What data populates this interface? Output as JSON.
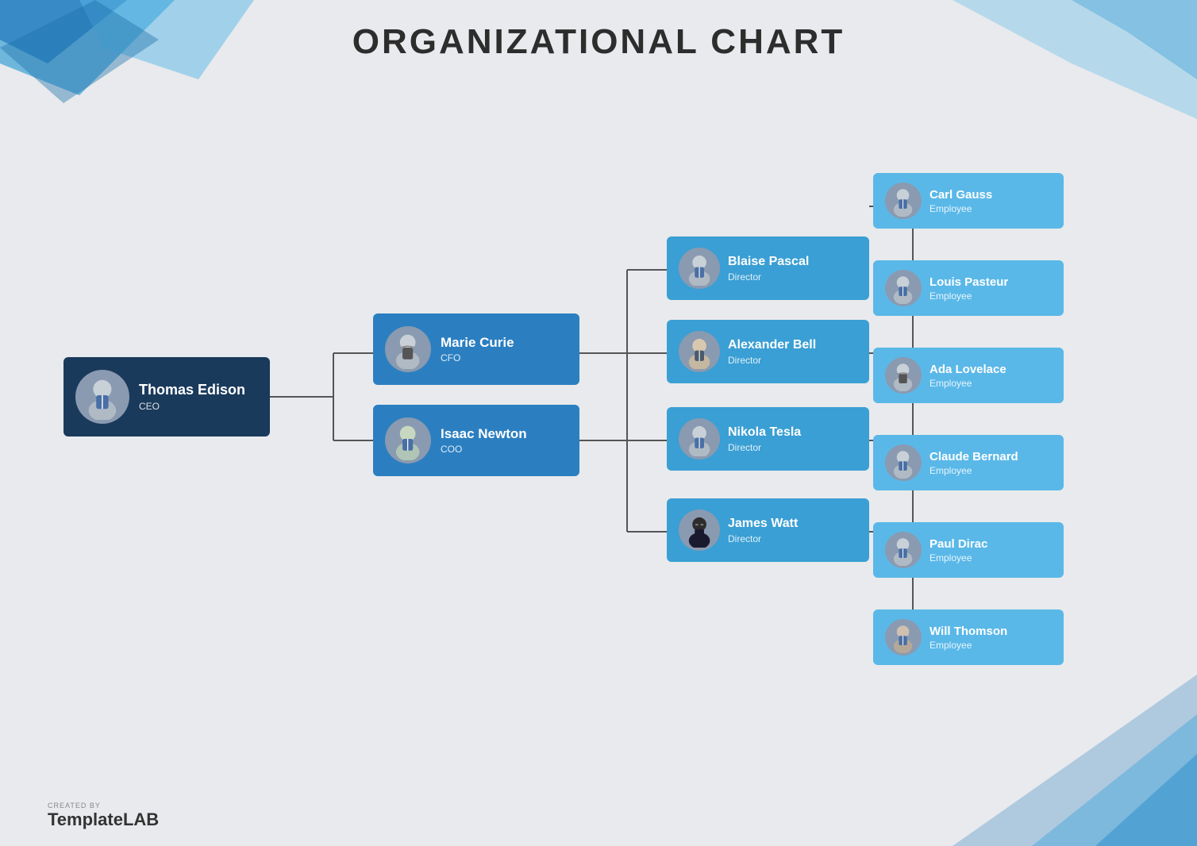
{
  "title": "ORGANIZATIONAL CHART",
  "ceo": {
    "name": "Thomas Edison",
    "role": "CEO"
  },
  "level2": [
    {
      "name": "Marie Curie",
      "role": "CFO",
      "gender": "female"
    },
    {
      "name": "Isaac Newton",
      "role": "COO",
      "gender": "male"
    }
  ],
  "level3": [
    {
      "name": "Blaise Pascal",
      "role": "Director",
      "gender": "male"
    },
    {
      "name": "Alexander Bell",
      "role": "Director",
      "gender": "male2"
    },
    {
      "name": "Nikola Tesla",
      "role": "Director",
      "gender": "male"
    },
    {
      "name": "James Watt",
      "role": "Director",
      "gender": "glasses"
    }
  ],
  "level4": [
    {
      "name": "Carl Gauss",
      "role": "Employee",
      "gender": "male"
    },
    {
      "name": "Louis Pasteur",
      "role": "Employee",
      "gender": "male"
    },
    {
      "name": "Ada Lovelace",
      "role": "Employee",
      "gender": "female"
    },
    {
      "name": "Claude Bernard",
      "role": "Employee",
      "gender": "male"
    },
    {
      "name": "Paul Dirac",
      "role": "Employee",
      "gender": "male"
    },
    {
      "name": "Will Thomson",
      "role": "Employee",
      "gender": "male"
    }
  ],
  "branding": {
    "created_by": "CREATED BY",
    "name_part1": "Template",
    "name_part2": "LAB"
  }
}
